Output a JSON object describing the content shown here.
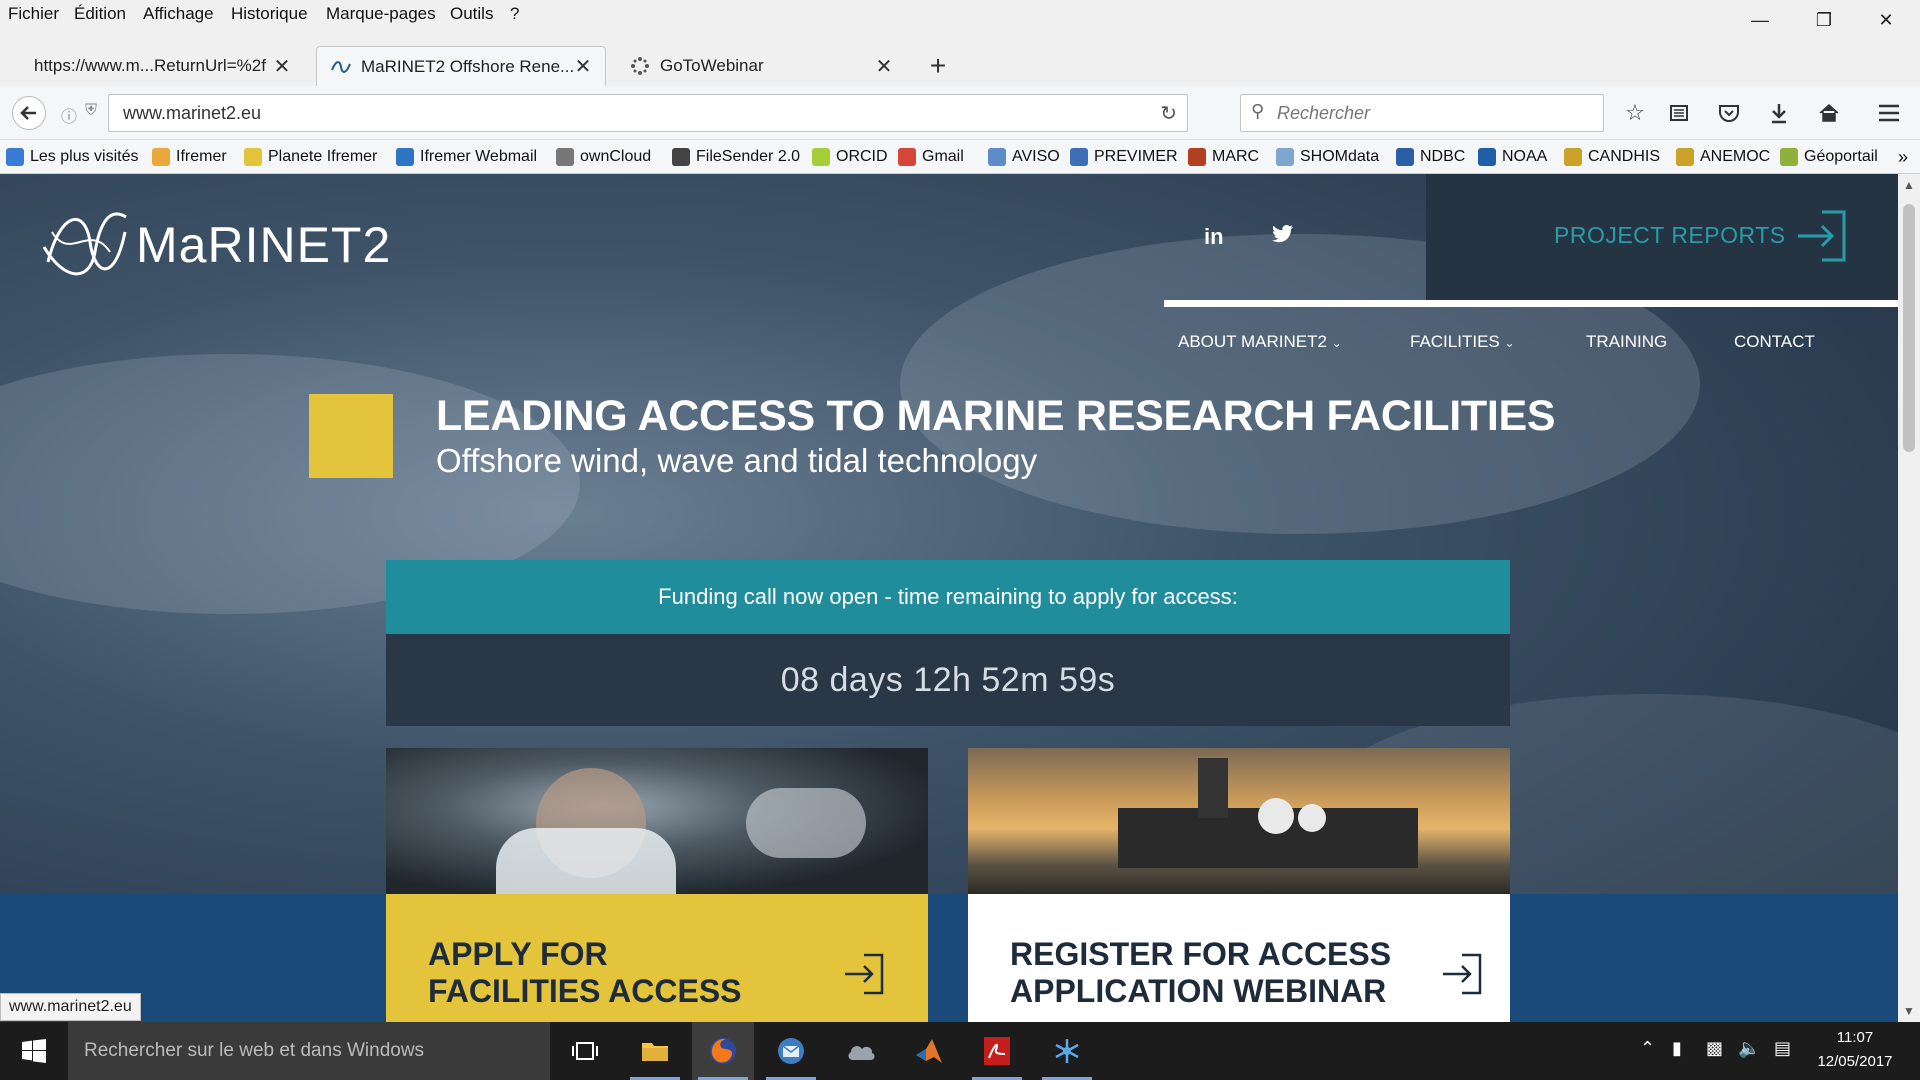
{
  "menubar": {
    "items": [
      "Fichier",
      "Édition",
      "Affichage",
      "Historique",
      "Marque-pages",
      "Outils",
      "?"
    ]
  },
  "tabs": [
    {
      "label": "https://www.m...ReturnUrl=%2f"
    },
    {
      "label": "MaRINET2 Offshore Rene..."
    },
    {
      "label": "GoToWebinar"
    }
  ],
  "navbar": {
    "url": "www.marinet2.eu",
    "search_placeholder": "Rechercher"
  },
  "bookmarks": [
    {
      "label": "Les plus visités",
      "color": "#3a7bd5"
    },
    {
      "label": "Ifremer",
      "color": "#e8a93a"
    },
    {
      "label": "Planete Ifremer",
      "color": "#e2c53a"
    },
    {
      "label": "Ifremer Webmail",
      "color": "#2d74c4"
    },
    {
      "label": "ownCloud",
      "color": "#777777"
    },
    {
      "label": "FileSender 2.0",
      "color": "#444444"
    },
    {
      "label": "ORCID",
      "color": "#a6ce39"
    },
    {
      "label": "Gmail",
      "color": "#d44638"
    },
    {
      "label": "AVISO",
      "color": "#5c8dc9"
    },
    {
      "label": "PREVIMER",
      "color": "#3c6fb5"
    },
    {
      "label": "MARC",
      "color": "#b04020"
    },
    {
      "label": "SHOMdata",
      "color": "#7fa6cf"
    },
    {
      "label": "NDBC",
      "color": "#2a5ea6"
    },
    {
      "label": "NOAA",
      "color": "#1f5fa8"
    },
    {
      "label": "CANDHIS",
      "color": "#c9a227"
    },
    {
      "label": "ANEMOC",
      "color": "#c9a227"
    },
    {
      "label": "Géoportail",
      "color": "#8fb03a"
    }
  ],
  "page": {
    "logo": "MaRINET2",
    "social": [
      "in",
      "t"
    ],
    "project_reports": "PROJECT REPORTS",
    "nav": [
      "ABOUT MARINET2",
      "FACILITIES",
      "TRAINING",
      "CONTACT"
    ],
    "headline": "LEADING ACCESS TO MARINE RESEARCH FACILITIES",
    "subhead": "Offshore wind, wave and tidal technology",
    "funding": "Funding call now open - time remaining to apply for access:",
    "countdown": "08 days 12h 52m 59s",
    "cards": [
      {
        "title": "APPLY FOR\nFACILITIES ACCESS",
        "color": "#e4c43a"
      },
      {
        "title": "REGISTER FOR ACCESS\nAPPLICATION WEBINAR",
        "color": "#ffffff"
      }
    ],
    "status_link": "www.marinet2.eu"
  },
  "colors": {
    "accent_teal": "#1f8d9c",
    "accent_yellow": "#e4c43a",
    "dark_panel": "#293746",
    "report_text": "#2a9ca8"
  },
  "taskbar": {
    "search": "Rechercher sur le web et dans Windows",
    "time": "11:07",
    "date": "12/05/2017"
  }
}
